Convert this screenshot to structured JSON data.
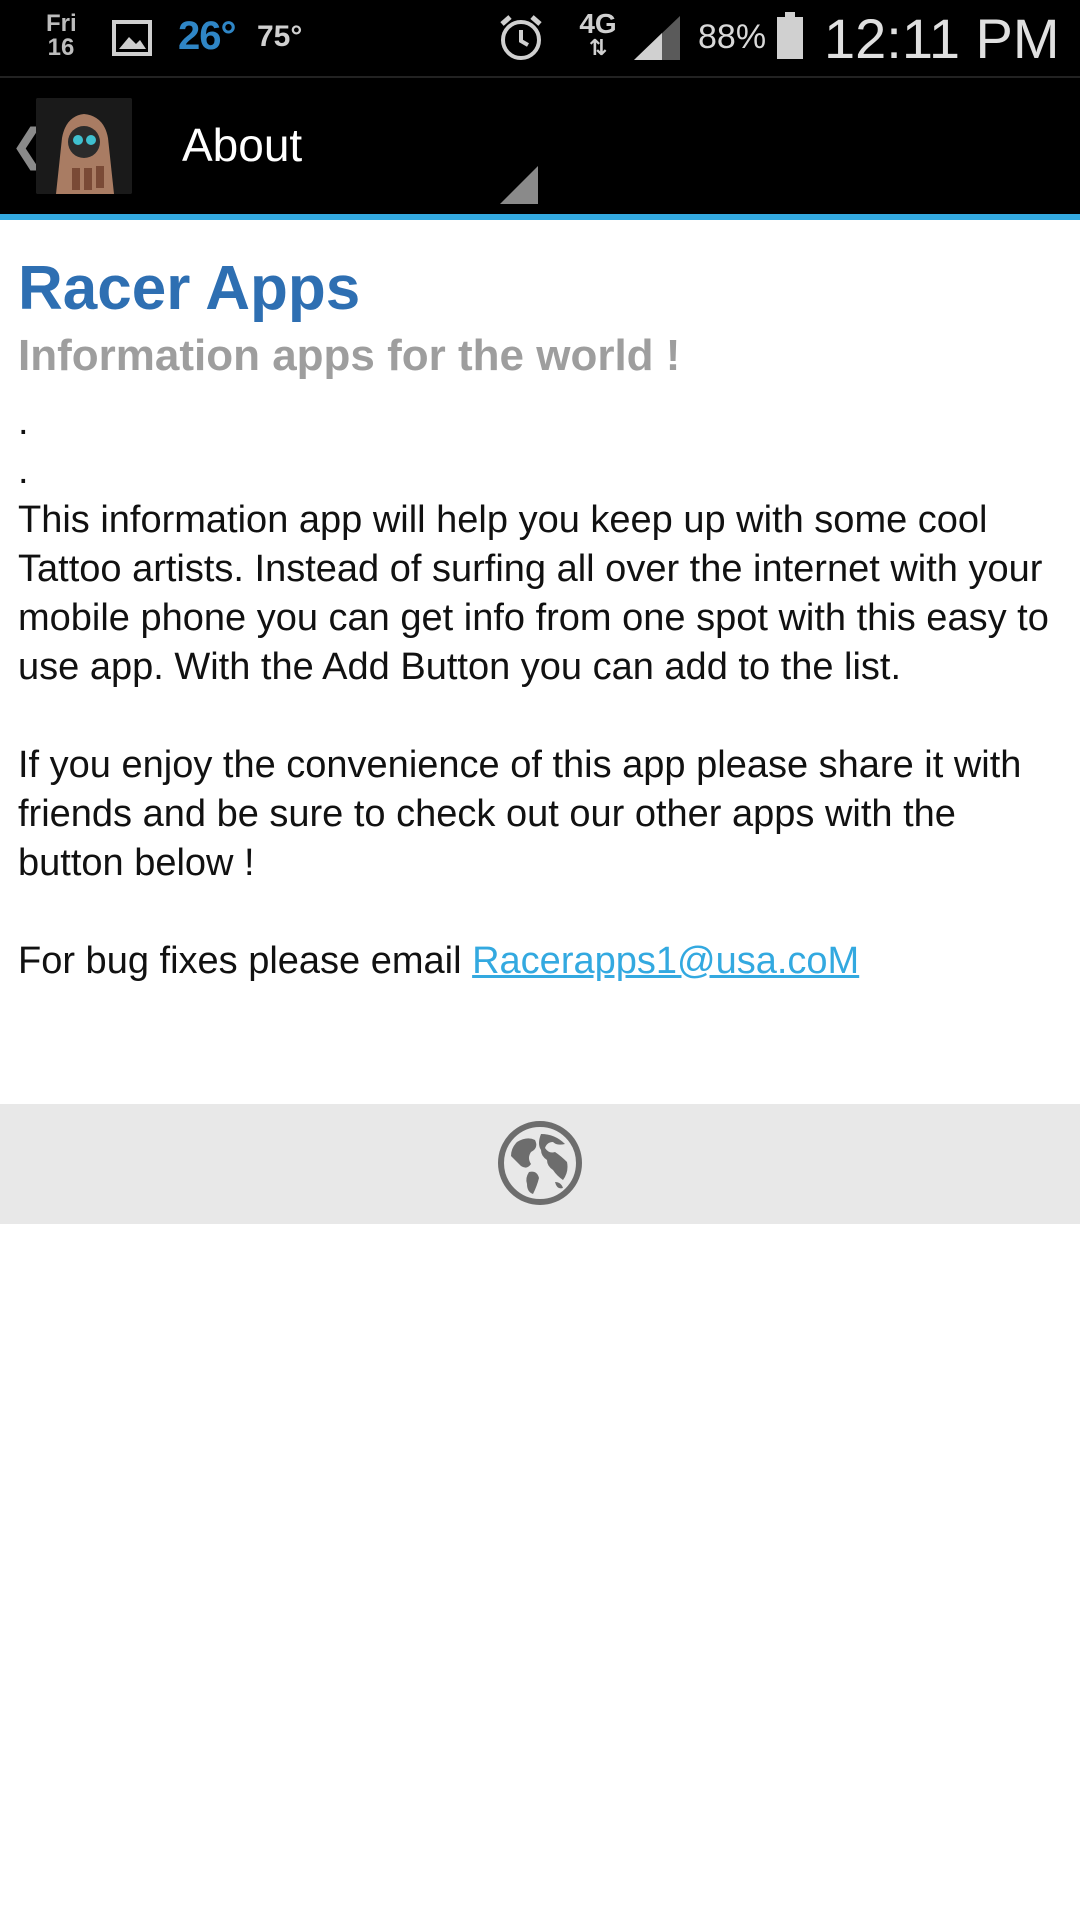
{
  "status_bar": {
    "day": "Fri",
    "date": "16",
    "temp_primary": "26°",
    "temp_secondary": "75°",
    "network": "4G",
    "network_arrows": "⇅",
    "battery_percent": "88%",
    "time": "12:11 PM",
    "icons": [
      "gallery-icon",
      "alarm-icon",
      "signal-icon",
      "battery-icon"
    ],
    "colors": {
      "temp_primary": "#2f86c6"
    }
  },
  "app_bar": {
    "up_caret": "❮",
    "title": "About"
  },
  "content": {
    "title": "Racer Apps",
    "subtitle": "Information apps for the world !",
    "dot_1": ".",
    "dot_2": ".",
    "paragraph_1": "This information app will help you keep up with some cool Tattoo artists. Instead of surfing all over the internet with your mobile phone you can get info from one spot with this easy to use app. With the Add Button you can add to the list.",
    "paragraph_2": "If you enjoy the convenience of this app please share it with friends and be sure to check out our other apps with the button below !",
    "bug_prefix": "For bug fixes please email ",
    "email": "Racerapps1@usa.coM"
  },
  "footer": {
    "button_icon": "globe-icon"
  },
  "colors": {
    "accent_line": "#33a9e0",
    "title": "#2e6fb2",
    "subtitle": "#9e9e9e",
    "link": "#33a9e0",
    "footer_bg": "#e8e8e8"
  }
}
